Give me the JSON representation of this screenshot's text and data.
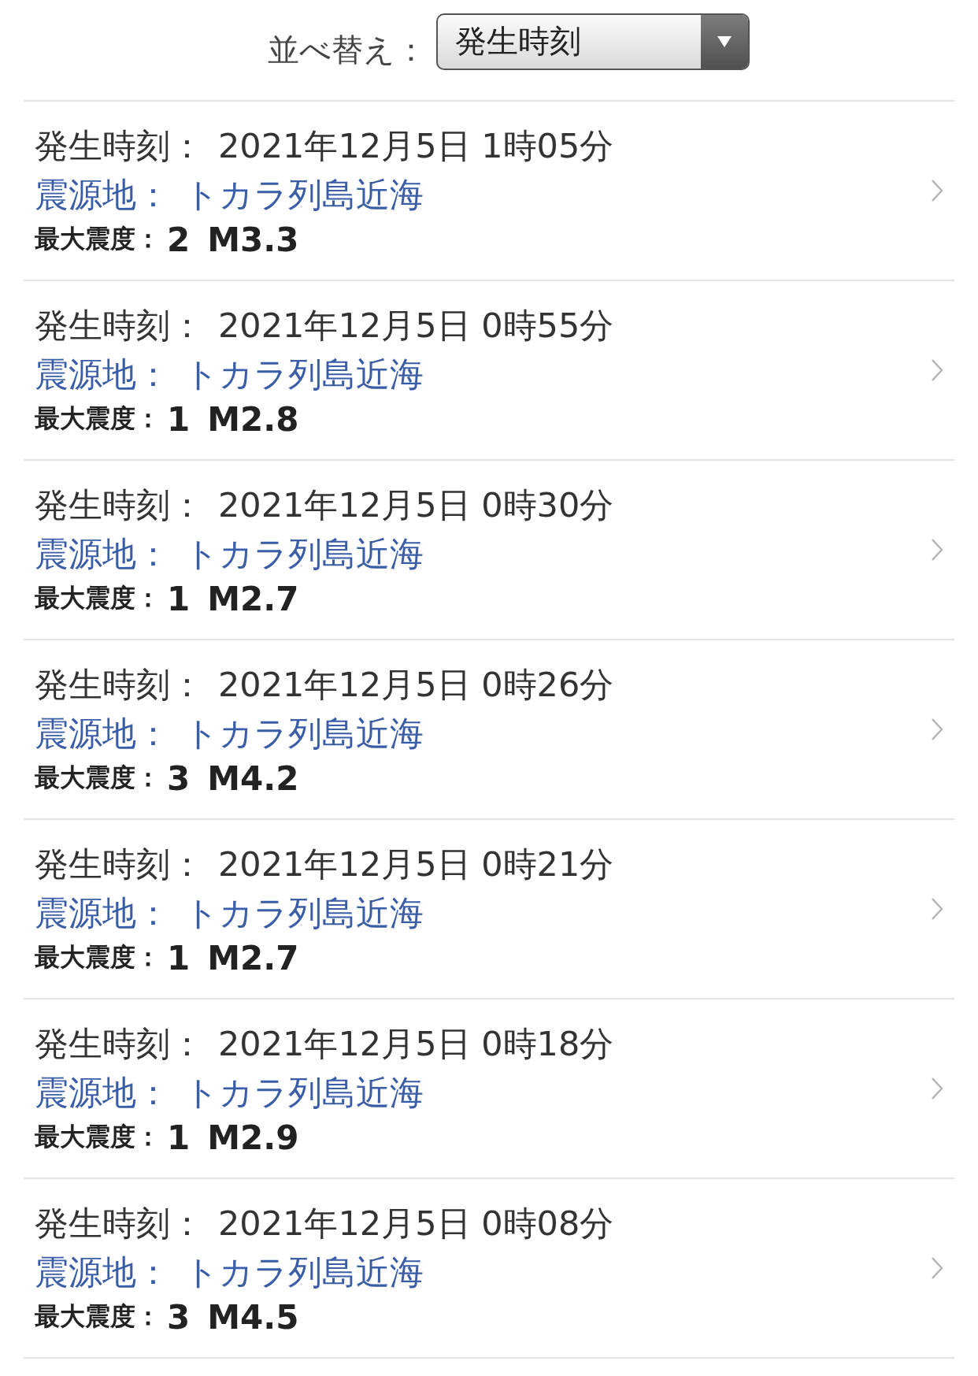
{
  "sort": {
    "label": "並べ替え：",
    "value": "発生時刻"
  },
  "quakes": [
    {
      "time_label": "発生時刻：",
      "time": "2021年12月5日 1時05分",
      "epicenter_label": "震源地：",
      "epicenter": "トカラ列島近海",
      "intensity_label": "最大震度：",
      "intensity": "2",
      "magnitude": "M3.3"
    },
    {
      "time_label": "発生時刻：",
      "time": "2021年12月5日 0時55分",
      "epicenter_label": "震源地：",
      "epicenter": "トカラ列島近海",
      "intensity_label": "最大震度：",
      "intensity": "1",
      "magnitude": "M2.8"
    },
    {
      "time_label": "発生時刻：",
      "time": "2021年12月5日 0時30分",
      "epicenter_label": "震源地：",
      "epicenter": "トカラ列島近海",
      "intensity_label": "最大震度：",
      "intensity": "1",
      "magnitude": "M2.7"
    },
    {
      "time_label": "発生時刻：",
      "time": "2021年12月5日 0時26分",
      "epicenter_label": "震源地：",
      "epicenter": "トカラ列島近海",
      "intensity_label": "最大震度：",
      "intensity": "3",
      "magnitude": "M4.2"
    },
    {
      "time_label": "発生時刻：",
      "time": "2021年12月5日 0時21分",
      "epicenter_label": "震源地：",
      "epicenter": "トカラ列島近海",
      "intensity_label": "最大震度：",
      "intensity": "1",
      "magnitude": "M2.7"
    },
    {
      "time_label": "発生時刻：",
      "time": "2021年12月5日 0時18分",
      "epicenter_label": "震源地：",
      "epicenter": "トカラ列島近海",
      "intensity_label": "最大震度：",
      "intensity": "1",
      "magnitude": "M2.9"
    },
    {
      "time_label": "発生時刻：",
      "time": "2021年12月5日 0時08分",
      "epicenter_label": "震源地：",
      "epicenter": "トカラ列島近海",
      "intensity_label": "最大震度：",
      "intensity": "3",
      "magnitude": "M4.5"
    }
  ]
}
